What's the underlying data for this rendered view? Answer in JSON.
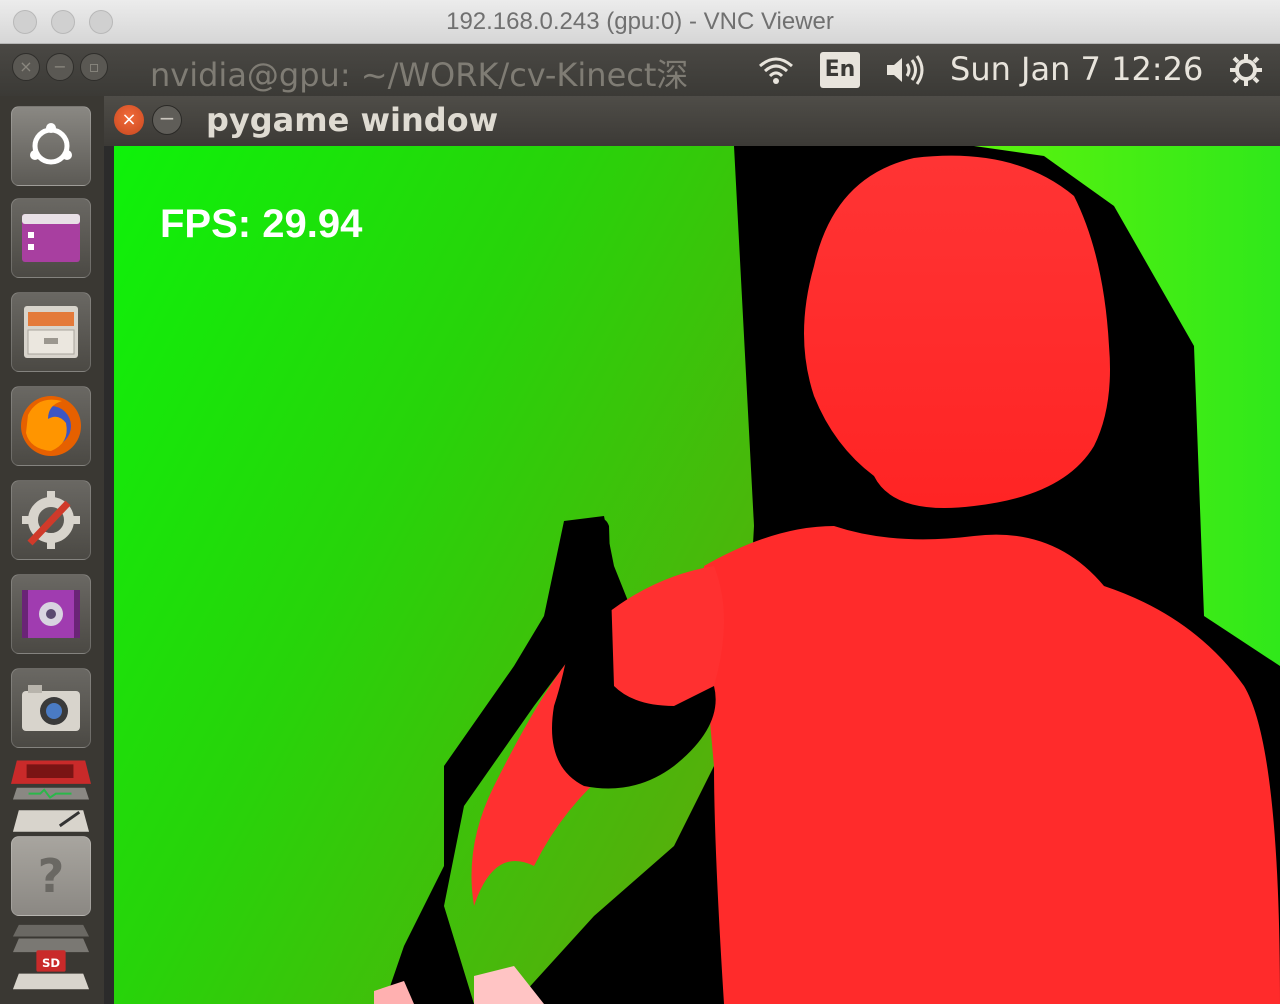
{
  "vnc_window": {
    "title": "192.168.0.243 (gpu:0) - VNC Viewer"
  },
  "top_panel": {
    "active_app_title": "nvidia@gpu: ~/WORK/cv-Kinect深",
    "keyboard_layout": "En",
    "clock": "Sun Jan  7 12:26",
    "icons": [
      "wifi-icon",
      "volume-icon",
      "system-gear-icon"
    ]
  },
  "launcher": {
    "items": [
      {
        "name": "ubuntu-dash-icon"
      },
      {
        "name": "software-center-icon"
      },
      {
        "name": "file-manager-icon"
      },
      {
        "name": "firefox-icon"
      },
      {
        "name": "system-settings-icon"
      },
      {
        "name": "video-player-icon"
      },
      {
        "name": "camera-icon"
      },
      {
        "name": "system-monitor-stack-icon"
      },
      {
        "name": "unknown-app-icon"
      },
      {
        "name": "sd-card-stack-icon"
      }
    ]
  },
  "pygame_window": {
    "title": "pygame window",
    "close_glyph": "×",
    "minimize_glyph": "−",
    "overlay": {
      "fps_text": "FPS: 29.94"
    },
    "colors": {
      "near": "#ff2a22",
      "mid": "#1ae808",
      "far": "#ffff00",
      "no_data": "#000000"
    }
  }
}
